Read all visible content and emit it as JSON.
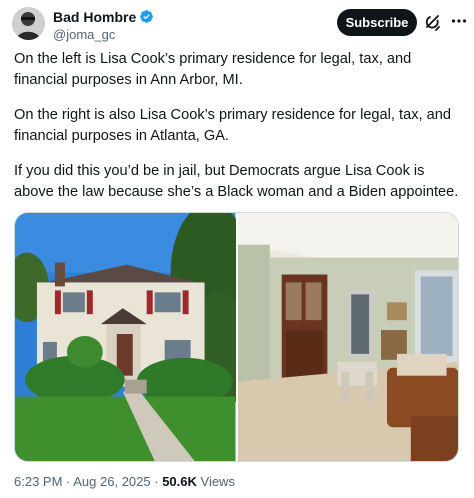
{
  "author": {
    "display_name": "Bad Hombre",
    "handle": "@joma_gc",
    "verified": true,
    "verified_color": "#1d9bf0"
  },
  "actions": {
    "subscribe_label": "Subscribe",
    "grok_icon": "grok-icon",
    "more_icon": "more-icon"
  },
  "tweet": {
    "paragraphs": [
      "On the left is Lisa Cook’s primary residence for legal, tax, and financial purposes in Ann Arbor, MI.",
      "On the right is also Lisa Cook’s primary residence for legal, tax, and financial purposes in Atlanta, GA.",
      "If you did this you’d be in jail, but Democrats argue Lisa Cook is above the law because she’s a Black woman and a Biden appointee."
    ]
  },
  "media": {
    "left_photo": "house-exterior-photo",
    "right_photo": "apartment-interior-photo"
  },
  "meta": {
    "time": "6:23 PM",
    "separator": " · ",
    "date": "Aug 26, 2025",
    "views_count": "50.6K",
    "views_label": " Views"
  }
}
